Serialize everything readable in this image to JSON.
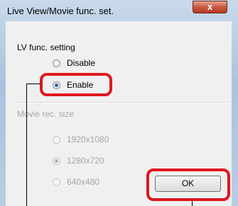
{
  "window": {
    "title": "Live View/Movie func. set.",
    "close_label": "x"
  },
  "lv_group": {
    "label": "LV func. setting",
    "options": [
      {
        "label": "Disable",
        "selected": false
      },
      {
        "label": "Enable",
        "selected": true
      }
    ]
  },
  "movie_group": {
    "label": "Movie rec. size",
    "options": [
      {
        "label": "1920x1080",
        "selected": false
      },
      {
        "label": "1280x720",
        "selected": true
      },
      {
        "label": "640x480",
        "selected": false
      }
    ]
  },
  "buttons": {
    "ok": "OK"
  },
  "colors": {
    "highlight": "#e0171f",
    "accent": "#2b5fb4"
  }
}
